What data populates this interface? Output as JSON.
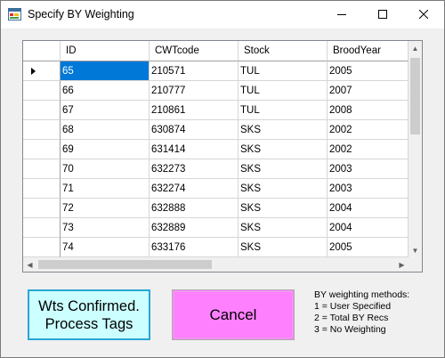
{
  "window": {
    "title": "Specify BY Weighting",
    "icon": "app-window-icon"
  },
  "titlebar_buttons": {
    "minimize_icon": "minimize-icon",
    "maximize_icon": "maximize-icon",
    "close_icon": "close-icon"
  },
  "grid": {
    "columns": [
      "ID",
      "CWTcode",
      "Stock",
      "BroodYear"
    ],
    "rows": [
      [
        "65",
        "210571",
        "TUL",
        "2005"
      ],
      [
        "66",
        "210777",
        "TUL",
        "2007"
      ],
      [
        "67",
        "210861",
        "TUL",
        "2008"
      ],
      [
        "68",
        "630874",
        "SKS",
        "2002"
      ],
      [
        "69",
        "631414",
        "SKS",
        "2002"
      ],
      [
        "70",
        "632273",
        "SKS",
        "2003"
      ],
      [
        "71",
        "632274",
        "SKS",
        "2003"
      ],
      [
        "72",
        "632888",
        "SKS",
        "2004"
      ],
      [
        "73",
        "632889",
        "SKS",
        "2004"
      ],
      [
        "74",
        "633176",
        "SKS",
        "2005"
      ]
    ],
    "selected_row": 0,
    "selected_col": 0,
    "current_row_icon": "current-row-arrow-icon"
  },
  "buttons": {
    "confirm_line1": "Wts Confirmed.",
    "confirm_line2": "Process Tags",
    "cancel": "Cancel"
  },
  "methods": {
    "heading": "BY weighting methods:",
    "items": [
      "1 = User Specified",
      "2 = Total BY Recs",
      "3 = No Weighting"
    ]
  },
  "colors": {
    "selection": "#0078d7",
    "confirm_bg": "#ccffff",
    "confirm_border": "#2aa6d6",
    "cancel_bg": "#ff80ff"
  }
}
